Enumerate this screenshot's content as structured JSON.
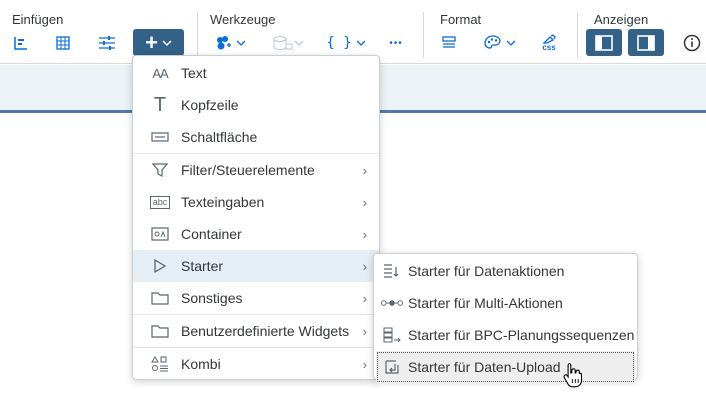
{
  "toolbar": {
    "groups": {
      "insert": "Einfügen",
      "tools": "Werkzeuge",
      "format": "Format",
      "view": "Anzeigen"
    },
    "icons": [
      "bar-chart-icon",
      "table-icon",
      "filter-sliders-icon",
      "plus-icon",
      "chevron-down-icon",
      "robot-icon",
      "data-disabled-icon",
      "braces-icon",
      "more-icon",
      "layout-icon",
      "palette-icon",
      "css-icon",
      "left-panel-toggle-icon",
      "right-panel-toggle-icon",
      "info-icon"
    ],
    "tools_braces": "{ }",
    "tools_more": "•••",
    "css_label": "css"
  },
  "menu": {
    "items": [
      {
        "label": "Text",
        "icon": "text-size-icon",
        "glyph": "AA",
        "submenu": false
      },
      {
        "label": "Kopfzeile",
        "icon": "heading-icon",
        "glyph": "T",
        "submenu": false
      },
      {
        "label": "Schaltfläche",
        "icon": "button-icon",
        "glyph": "",
        "submenu": false
      },
      {
        "label": "Filter/Steuerelemente",
        "icon": "filter-icon",
        "glyph": "",
        "submenu": true
      },
      {
        "label": "Texteingaben",
        "icon": "text-input-icon",
        "glyph": "abc",
        "submenu": true
      },
      {
        "label": "Container",
        "icon": "container-icon",
        "glyph": "",
        "submenu": true
      },
      {
        "label": "Starter",
        "icon": "play-icon",
        "glyph": "",
        "submenu": true,
        "active": true
      },
      {
        "label": "Sonstiges",
        "icon": "folder-icon",
        "glyph": "",
        "submenu": true
      },
      {
        "label": "Benutzerdefinierte Widgets",
        "icon": "custom-widget-folder-icon",
        "glyph": "",
        "submenu": true
      },
      {
        "label": "Kombi",
        "icon": "combo-icon",
        "glyph": "",
        "submenu": true
      }
    ]
  },
  "submenu": {
    "items": [
      {
        "label": "Starter für Datenaktionen",
        "icon": "data-action-icon"
      },
      {
        "label": "Starter für Multi-Aktionen",
        "icon": "multi-action-icon"
      },
      {
        "label": "Starter für BPC-Planungssequenzen",
        "icon": "bpc-sequence-icon"
      },
      {
        "label": "Starter für Daten-Upload",
        "icon": "data-upload-icon",
        "hover": true
      }
    ]
  },
  "colors": {
    "accent": "#0a6ed1",
    "button_dark": "#346187",
    "active_row": "#e5edf5",
    "subbar": "#edf2f7"
  }
}
